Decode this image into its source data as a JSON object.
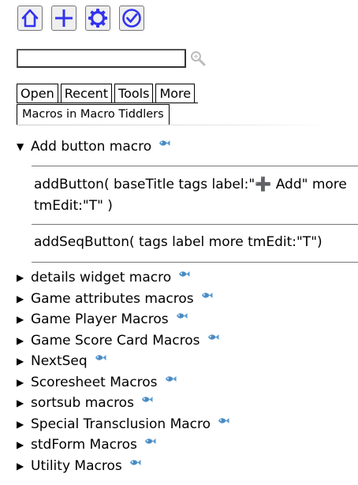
{
  "toolbar": {
    "buttons": [
      {
        "icon": "home-icon"
      },
      {
        "icon": "plus-icon"
      },
      {
        "icon": "gear-icon"
      },
      {
        "icon": "check-circle-icon"
      }
    ],
    "accent_color": "#3333ee"
  },
  "search": {
    "value": "",
    "placeholder": ""
  },
  "tabs": {
    "row1": [
      "Open",
      "Recent",
      "Tools",
      "More"
    ],
    "selected": "Macros in Macro Tiddlers"
  },
  "open_section": {
    "title": "Add button macro",
    "macros": [
      "addButton( baseTitle tags label:\"➕ Add\" more tmEdit:\"T\" )",
      "addSeqButton( tags label more tmEdit:\"T\")"
    ]
  },
  "collapsed_sections": [
    "details widget macro",
    "Game attributes macros",
    "Game Player Macros",
    "Game Score Card Macros",
    "NextSeq",
    "Scoresheet Macros",
    "sortsub macros",
    "Special Transclusion Macro",
    "stdForm Macros",
    "Utility Macros"
  ]
}
